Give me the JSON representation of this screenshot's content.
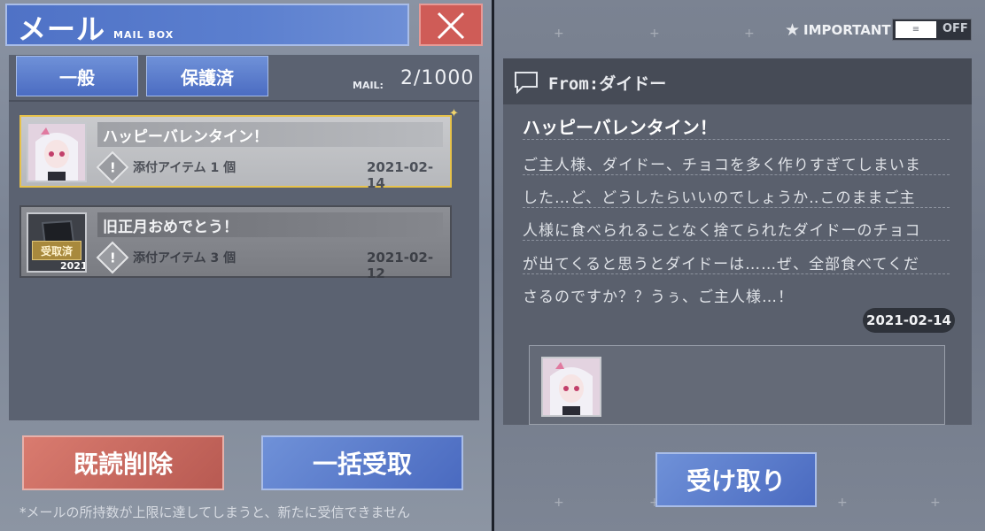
{
  "header": {
    "title": "メール",
    "subtitle": "MAIL BOX"
  },
  "tabs": [
    {
      "label": "一般"
    },
    {
      "label": "保護済"
    }
  ],
  "mail_count": {
    "label": "MAIL:",
    "value": "2/1000"
  },
  "mails": [
    {
      "subject": "ハッピーバレンタイン！",
      "attachment": "添付アイテム 1 個",
      "date": "2021-02-14",
      "selected": true
    },
    {
      "subject": "旧正月おめでとう！",
      "attachment": "添付アイテム 3 個",
      "date": "2021-02-12",
      "badge": "受取済",
      "thumb_caption": "2021"
    }
  ],
  "buttons": {
    "delete_read": "既読削除",
    "collect_all": "一括受取",
    "receive": "受け取り"
  },
  "footnote": "*メールの所持数が上限に達してしまうと、新たに受信できません",
  "important": {
    "label": "IMPORTANT",
    "toggle_state": "OFF",
    "toggle_knob": "≡"
  },
  "detail": {
    "from": "From:ダイドー",
    "subject": "ハッピーバレンタイン！",
    "body_lines": [
      "ご主人様、ダイドー、チョコを多く作りすぎてしまいま",
      "した…ど、どうしたらいいのでしょうか‥このままご主",
      "人様に食べられることなく捨てられたダイドーのチョコ",
      "が出てくると思うとダイドーは……ぜ、全部食べてくだ",
      "さるのですか？？うぅ、ご主人様…！"
    ],
    "date": "2021-02-14"
  },
  "colors": {
    "accent_blue": "#4f72c6",
    "delete_red": "#cf5c57",
    "selected_border": "#e7c24a"
  }
}
